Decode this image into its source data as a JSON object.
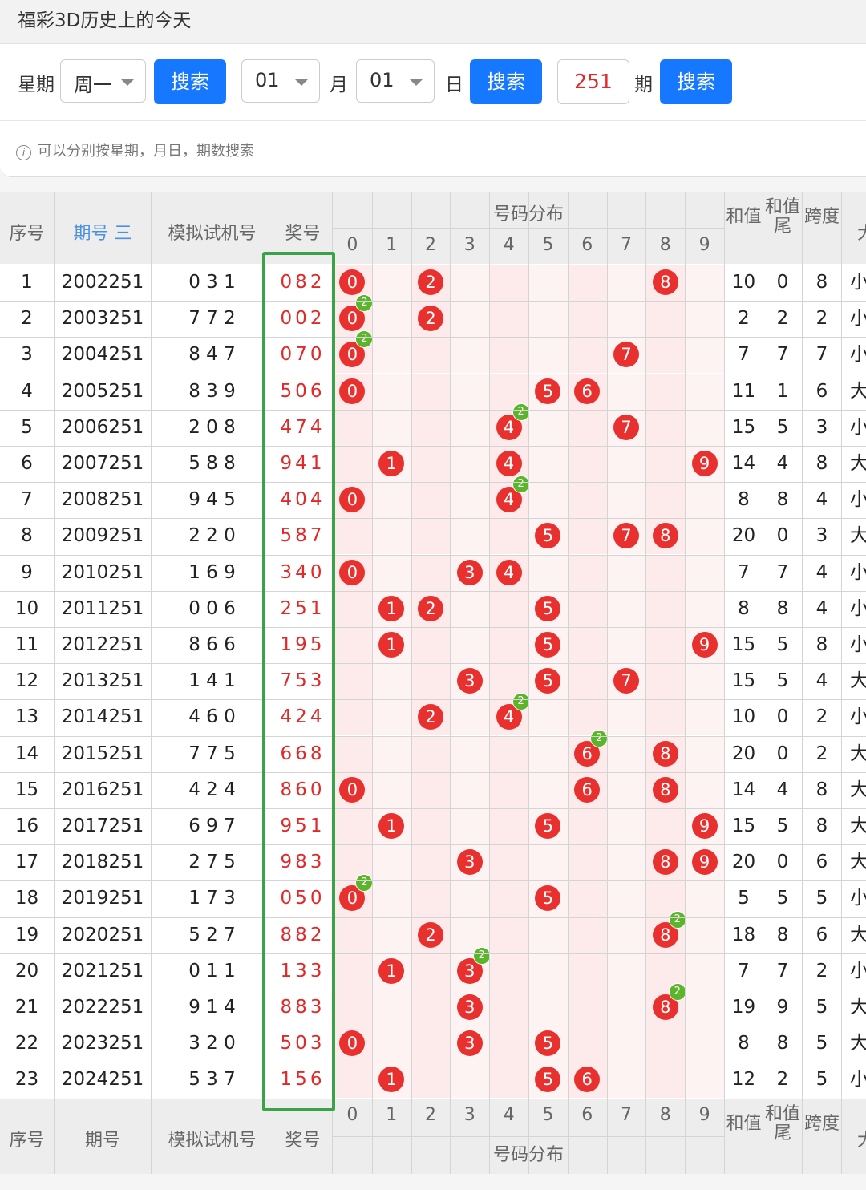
{
  "page_title": "福彩3D历史上的今天",
  "search": {
    "weekday_label": "星期",
    "weekday_value": "周一",
    "search_label": "搜索",
    "month_value": "01",
    "month_label": "月",
    "day_value": "01",
    "day_label": "日",
    "issue_value": "251",
    "issue_label": "期",
    "hint": "可以分别按星期，月日，期数搜索"
  },
  "table": {
    "header": {
      "seq": "序号",
      "issue": "期号",
      "sort_icon": "三",
      "sim": "模拟试机号",
      "win": "奖号",
      "dist": "号码分布",
      "digits": [
        "0",
        "1",
        "2",
        "3",
        "4",
        "5",
        "6",
        "7",
        "8",
        "9"
      ],
      "sum": "和值",
      "sum_tail": "和值尾",
      "span": "跨度",
      "size_partial": "大"
    },
    "rows": [
      {
        "seq": "1",
        "issue": "2002251",
        "sim": "0 3 1",
        "win": "082",
        "balls": [
          0,
          2,
          8
        ],
        "dups": [],
        "sum": "10",
        "tail": "0",
        "span": "8",
        "size": "小"
      },
      {
        "seq": "2",
        "issue": "2003251",
        "sim": "7 7 2",
        "win": "002",
        "balls": [
          0,
          2
        ],
        "dups": [
          0
        ],
        "sum": "2",
        "tail": "2",
        "span": "2",
        "size": "小"
      },
      {
        "seq": "3",
        "issue": "2004251",
        "sim": "8 4 7",
        "win": "070",
        "balls": [
          0,
          7
        ],
        "dups": [
          0
        ],
        "sum": "7",
        "tail": "7",
        "span": "7",
        "size": "小"
      },
      {
        "seq": "4",
        "issue": "2005251",
        "sim": "8 3 9",
        "win": "506",
        "balls": [
          0,
          5,
          6
        ],
        "dups": [],
        "sum": "11",
        "tail": "1",
        "span": "6",
        "size": "大"
      },
      {
        "seq": "5",
        "issue": "2006251",
        "sim": "2 0 8",
        "win": "474",
        "balls": [
          4,
          7
        ],
        "dups": [
          4
        ],
        "sum": "15",
        "tail": "5",
        "span": "3",
        "size": "小"
      },
      {
        "seq": "6",
        "issue": "2007251",
        "sim": "5 8 8",
        "win": "941",
        "balls": [
          1,
          4,
          9
        ],
        "dups": [],
        "sum": "14",
        "tail": "4",
        "span": "8",
        "size": "大"
      },
      {
        "seq": "7",
        "issue": "2008251",
        "sim": "9 4 5",
        "win": "404",
        "balls": [
          0,
          4
        ],
        "dups": [
          4
        ],
        "sum": "8",
        "tail": "8",
        "span": "4",
        "size": "小"
      },
      {
        "seq": "8",
        "issue": "2009251",
        "sim": "2 2 0",
        "win": "587",
        "balls": [
          5,
          7,
          8
        ],
        "dups": [],
        "sum": "20",
        "tail": "0",
        "span": "3",
        "size": "大"
      },
      {
        "seq": "9",
        "issue": "2010251",
        "sim": "1 6 9",
        "win": "340",
        "balls": [
          0,
          3,
          4
        ],
        "dups": [],
        "sum": "7",
        "tail": "7",
        "span": "4",
        "size": "小"
      },
      {
        "seq": "10",
        "issue": "2011251",
        "sim": "0 0 6",
        "win": "251",
        "balls": [
          1,
          2,
          5
        ],
        "dups": [],
        "sum": "8",
        "tail": "8",
        "span": "4",
        "size": "小"
      },
      {
        "seq": "11",
        "issue": "2012251",
        "sim": "8 6 6",
        "win": "195",
        "balls": [
          1,
          5,
          9
        ],
        "dups": [],
        "sum": "15",
        "tail": "5",
        "span": "8",
        "size": "小"
      },
      {
        "seq": "12",
        "issue": "2013251",
        "sim": "1 4 1",
        "win": "753",
        "balls": [
          3,
          5,
          7
        ],
        "dups": [],
        "sum": "15",
        "tail": "5",
        "span": "4",
        "size": "大"
      },
      {
        "seq": "13",
        "issue": "2014251",
        "sim": "4 6 0",
        "win": "424",
        "balls": [
          2,
          4
        ],
        "dups": [
          4
        ],
        "sum": "10",
        "tail": "0",
        "span": "2",
        "size": "小"
      },
      {
        "seq": "14",
        "issue": "2015251",
        "sim": "7 7 5",
        "win": "668",
        "balls": [
          6,
          8
        ],
        "dups": [
          6
        ],
        "sum": "20",
        "tail": "0",
        "span": "2",
        "size": "大"
      },
      {
        "seq": "15",
        "issue": "2016251",
        "sim": "4 2 4",
        "win": "860",
        "balls": [
          0,
          6,
          8
        ],
        "dups": [],
        "sum": "14",
        "tail": "4",
        "span": "8",
        "size": "大"
      },
      {
        "seq": "16",
        "issue": "2017251",
        "sim": "6 9 7",
        "win": "951",
        "balls": [
          1,
          5,
          9
        ],
        "dups": [],
        "sum": "15",
        "tail": "5",
        "span": "8",
        "size": "大"
      },
      {
        "seq": "17",
        "issue": "2018251",
        "sim": "2 7 5",
        "win": "983",
        "balls": [
          3,
          8,
          9
        ],
        "dups": [],
        "sum": "20",
        "tail": "0",
        "span": "6",
        "size": "大"
      },
      {
        "seq": "18",
        "issue": "2019251",
        "sim": "1 7 3",
        "win": "050",
        "balls": [
          0,
          5
        ],
        "dups": [
          0
        ],
        "sum": "5",
        "tail": "5",
        "span": "5",
        "size": "小"
      },
      {
        "seq": "19",
        "issue": "2020251",
        "sim": "5 2 7",
        "win": "882",
        "balls": [
          2,
          8
        ],
        "dups": [
          8
        ],
        "sum": "18",
        "tail": "8",
        "span": "6",
        "size": "大"
      },
      {
        "seq": "20",
        "issue": "2021251",
        "sim": "0 1 1",
        "win": "133",
        "balls": [
          1,
          3
        ],
        "dups": [
          3
        ],
        "sum": "7",
        "tail": "7",
        "span": "2",
        "size": "小"
      },
      {
        "seq": "21",
        "issue": "2022251",
        "sim": "9 1 4",
        "win": "883",
        "balls": [
          3,
          8
        ],
        "dups": [
          8
        ],
        "sum": "19",
        "tail": "9",
        "span": "5",
        "size": "大"
      },
      {
        "seq": "22",
        "issue": "2023251",
        "sim": "3 2 0",
        "win": "503",
        "balls": [
          0,
          3,
          5
        ],
        "dups": [],
        "sum": "8",
        "tail": "8",
        "span": "5",
        "size": "大"
      },
      {
        "seq": "23",
        "issue": "2024251",
        "sim": "5 3 7",
        "win": "156",
        "balls": [
          1,
          5,
          6
        ],
        "dups": [],
        "sum": "12",
        "tail": "2",
        "span": "5",
        "size": "小"
      }
    ],
    "dup_badge": "2"
  },
  "colors": {
    "ball": "#e8312f",
    "dup": "#5ab52a",
    "button": "#1677ff",
    "highlight_box": "#3aa34a"
  }
}
